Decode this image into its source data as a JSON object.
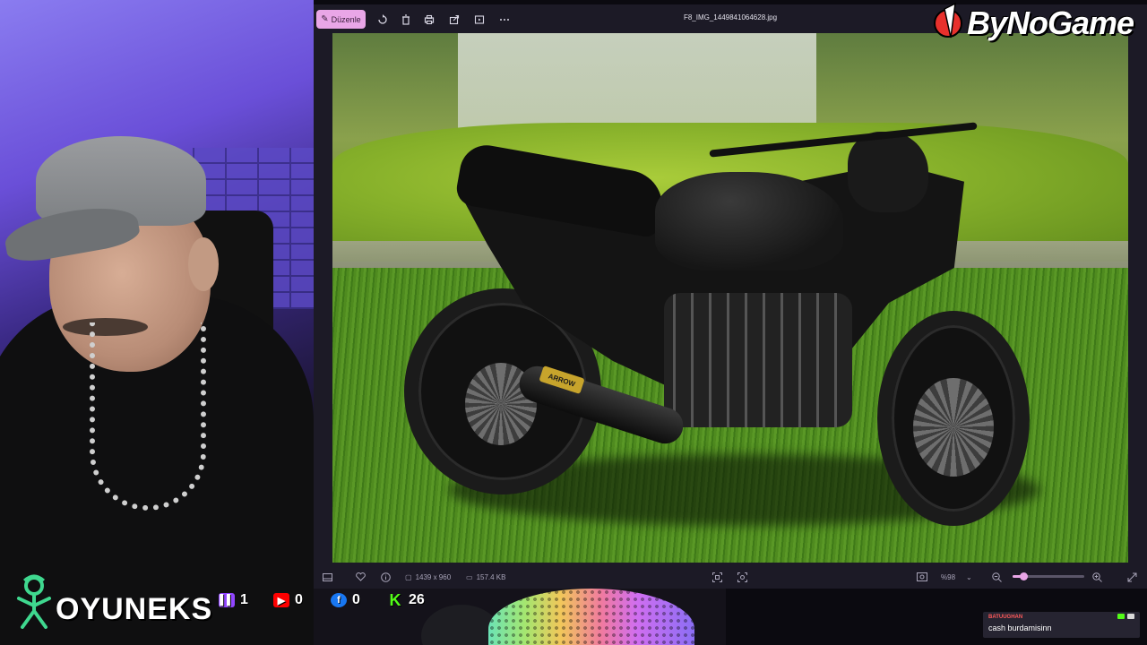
{
  "viewer": {
    "toolbar": {
      "edit_label": "Düzenle",
      "file_name": "F8_IMG_1449841064628.jpg"
    },
    "photo": {
      "exhaust_brand": "ARROW"
    },
    "statusbar": {
      "dimensions": "1439 x 960",
      "file_size": "157.4 KB",
      "zoom_label": "%98",
      "zoom_level": 0.15
    }
  },
  "brand": {
    "name": "ByNoGame"
  },
  "overlay": {
    "channel_name": "OYUNEKS",
    "stats": [
      {
        "platform": "twitch",
        "value": "1",
        "color": "#9146ff"
      },
      {
        "platform": "youtube",
        "value": "0",
        "color": "#ff0000"
      },
      {
        "platform": "facebook",
        "value": "0",
        "color": "#1877f2"
      },
      {
        "platform": "kick",
        "value": "26",
        "color": "#53fc18"
      }
    ]
  },
  "chat": {
    "username": "BATUUGHAN",
    "message": "cash burdamisinn"
  }
}
